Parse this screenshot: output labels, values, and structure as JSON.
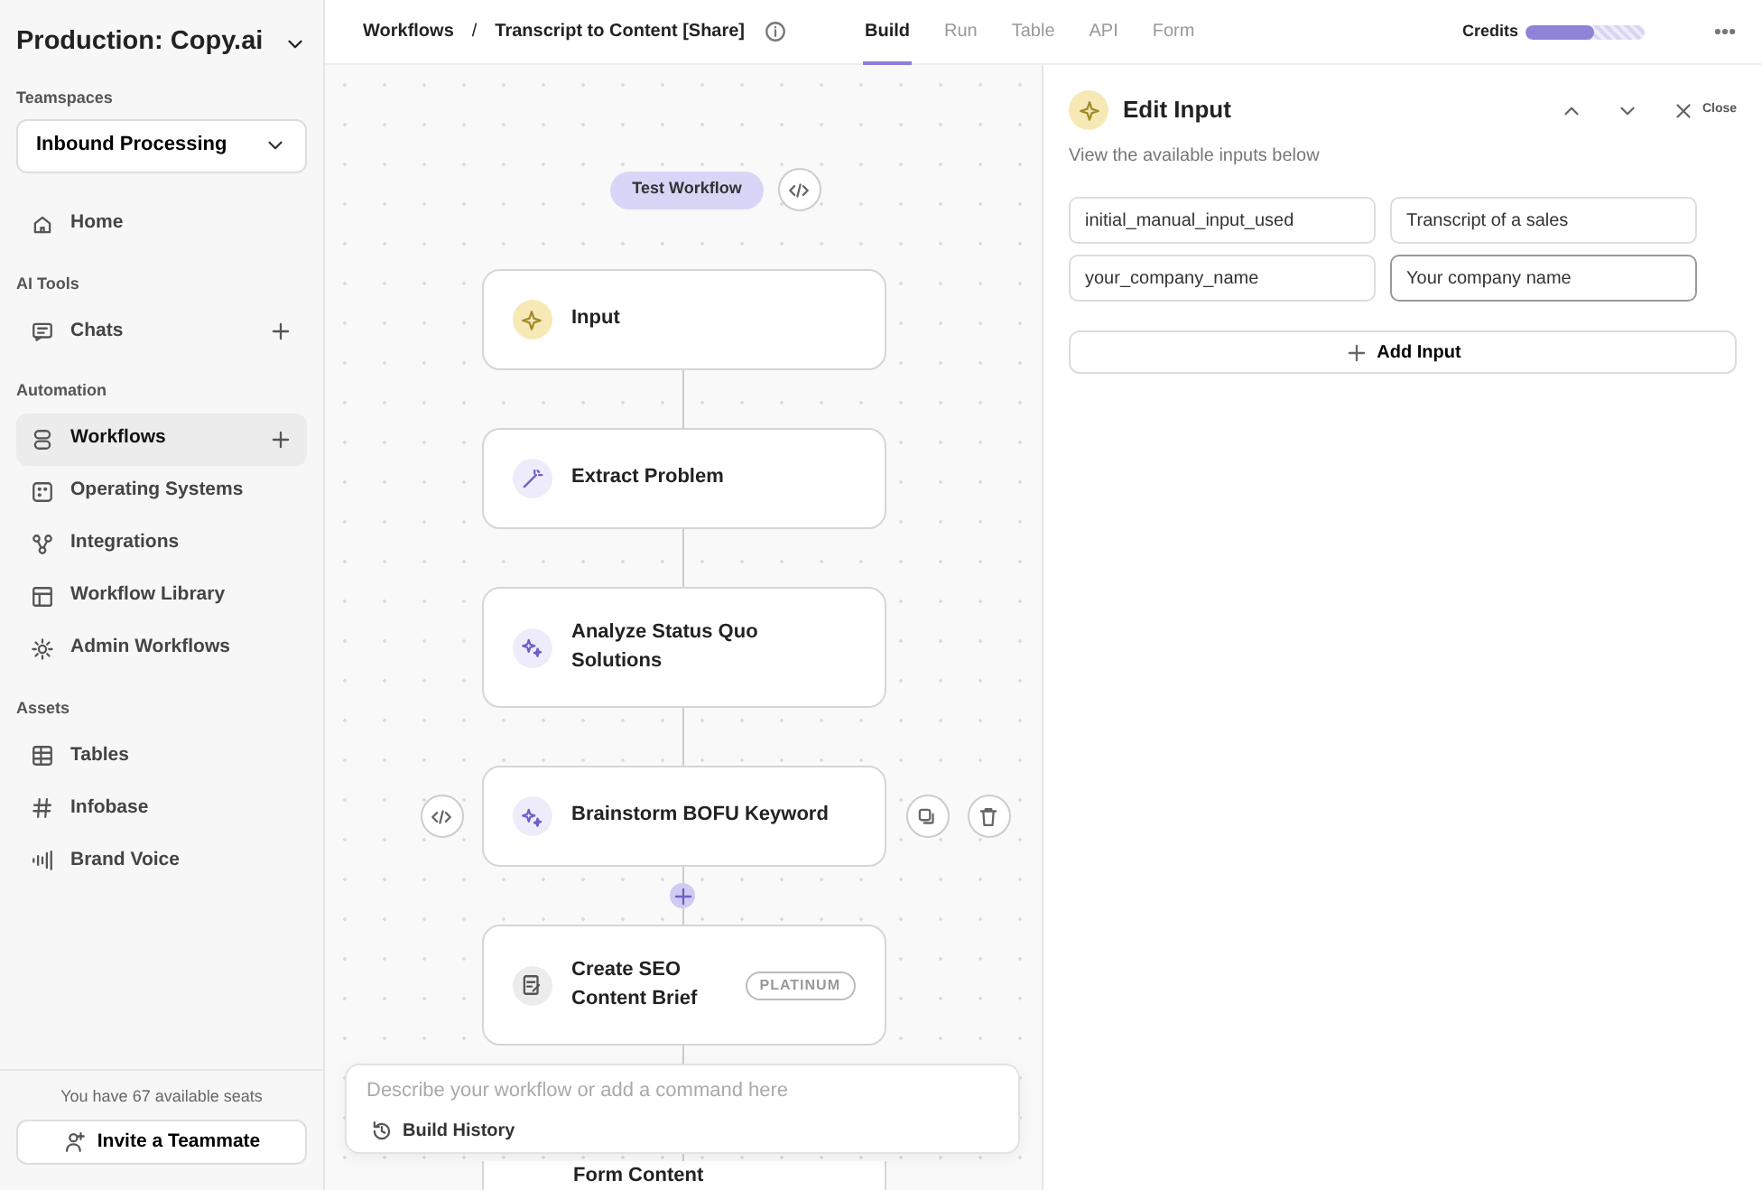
{
  "sidebar": {
    "workspace": "Production: Copy.ai",
    "teamspaces_label": "Teamspaces",
    "teamspace": "Inbound Processing",
    "sections": [
      {
        "items": [
          {
            "label": "Home",
            "selected": false,
            "has_add": false
          }
        ]
      },
      {
        "label": "AI Tools",
        "items": [
          {
            "label": "Chats",
            "selected": false,
            "has_add": true
          }
        ]
      },
      {
        "label": "Automation",
        "items": [
          {
            "label": "Workflows",
            "selected": true,
            "has_add": true
          },
          {
            "label": "Operating Systems",
            "selected": false,
            "has_add": false
          },
          {
            "label": "Integrations",
            "selected": false,
            "has_add": false
          },
          {
            "label": "Workflow Library",
            "selected": false,
            "has_add": false
          },
          {
            "label": "Admin Workflows",
            "selected": false,
            "has_add": false
          }
        ]
      },
      {
        "label": "Assets",
        "items": [
          {
            "label": "Tables",
            "selected": false,
            "has_add": false
          },
          {
            "label": "Infobase",
            "selected": false,
            "has_add": false
          },
          {
            "label": "Brand Voice",
            "selected": false,
            "has_add": false
          }
        ]
      }
    ],
    "seats_note": "You have 67 available seats",
    "invite_button": "Invite a Teammate"
  },
  "header": {
    "breadcrumb": [
      "Workflows",
      "Transcript to Content [Share]"
    ],
    "separator": "/",
    "tabs": [
      {
        "label": "Build",
        "selected": true
      },
      {
        "label": "Run",
        "selected": false
      },
      {
        "label": "Table",
        "selected": false
      },
      {
        "label": "API",
        "selected": false
      },
      {
        "label": "Form",
        "selected": false
      }
    ],
    "credits": {
      "label": "Credits",
      "level": 0.57
    }
  },
  "canvas": {
    "test_button": "Test Workflow",
    "nodes": [
      {
        "title": "Input",
        "kind": "input",
        "show_actions": false
      },
      {
        "title": "Extract Problem",
        "kind": "extract",
        "show_actions": false
      },
      {
        "title": "Analyze Status Quo Solutions",
        "kind": "ai",
        "show_actions": false
      },
      {
        "title": "Brainstorm BOFU Keyword",
        "kind": "ai",
        "show_actions": true
      },
      {
        "title": "Create SEO Content Brief",
        "kind": "brief",
        "badge": "PLATINUM",
        "show_actions": false
      },
      {
        "title": "Form Content",
        "kind": "partial",
        "show_actions": false
      }
    ],
    "command": {
      "placeholder": "Describe your workflow or add a command here",
      "history_button": "Build History"
    }
  },
  "panel": {
    "title": "Edit Input",
    "close": "Close",
    "subtitle": "View the available inputs below",
    "inputs": [
      {
        "name": "initial_manual_input_used",
        "value": "Transcript of a sales",
        "focused": false
      },
      {
        "name": "your_company_name",
        "value": "Your company name",
        "focused": true
      }
    ],
    "add_button": "Add Input"
  }
}
